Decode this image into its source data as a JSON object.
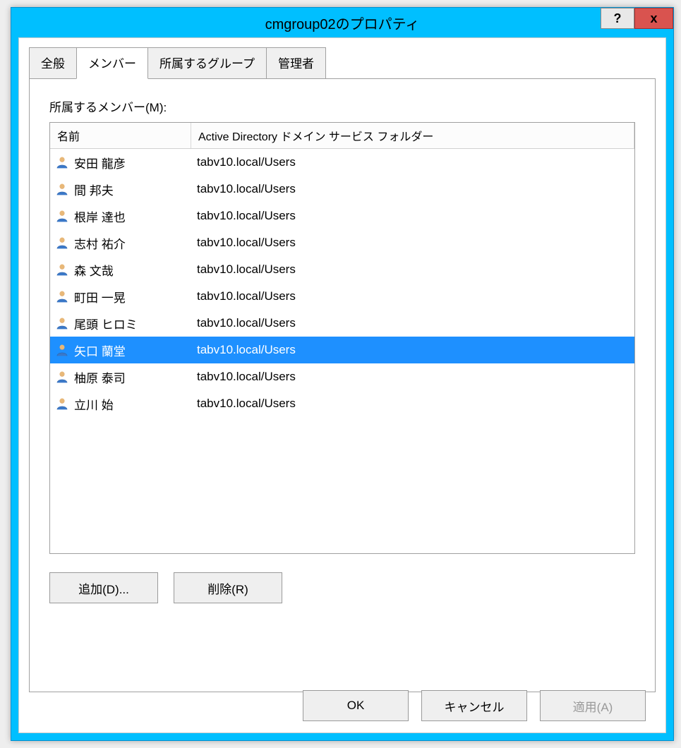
{
  "window": {
    "title": "cmgroup02のプロパティ"
  },
  "tabs": [
    {
      "label": "全般",
      "active": false
    },
    {
      "label": "メンバー",
      "active": true
    },
    {
      "label": "所属するグループ",
      "active": false
    },
    {
      "label": "管理者",
      "active": false
    }
  ],
  "members_label": "所属するメンバー(M):",
  "columns": {
    "name": "名前",
    "folder": "Active Directory ドメイン サービス フォルダー"
  },
  "members": [
    {
      "name": "安田 龍彦",
      "folder": "tabv10.local/Users",
      "selected": false
    },
    {
      "name": "間 邦夫",
      "folder": "tabv10.local/Users",
      "selected": false
    },
    {
      "name": "根岸 達也",
      "folder": "tabv10.local/Users",
      "selected": false
    },
    {
      "name": "志村 祐介",
      "folder": "tabv10.local/Users",
      "selected": false
    },
    {
      "name": "森 文哉",
      "folder": "tabv10.local/Users",
      "selected": false
    },
    {
      "name": "町田 一晃",
      "folder": "tabv10.local/Users",
      "selected": false
    },
    {
      "name": "尾頭 ヒロミ",
      "folder": "tabv10.local/Users",
      "selected": false
    },
    {
      "name": "矢口 蘭堂",
      "folder": "tabv10.local/Users",
      "selected": true
    },
    {
      "name": "柚原 泰司",
      "folder": "tabv10.local/Users",
      "selected": false
    },
    {
      "name": "立川 始",
      "folder": "tabv10.local/Users",
      "selected": false
    }
  ],
  "buttons": {
    "add": "追加(D)...",
    "remove": "削除(R)",
    "ok": "OK",
    "cancel": "キャンセル",
    "apply": "適用(A)"
  }
}
